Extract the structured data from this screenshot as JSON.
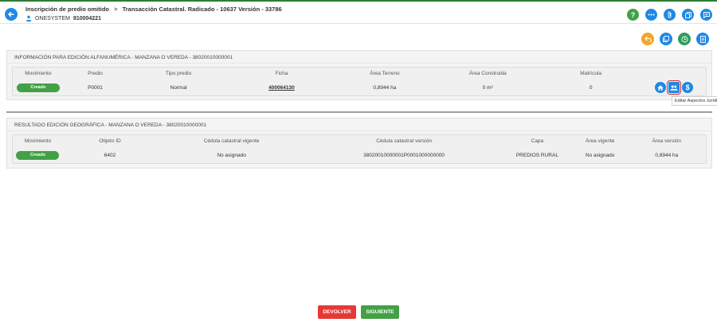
{
  "header": {
    "breadcrumb_1": "Inscripción de predio omitido",
    "breadcrumb_sep": ">",
    "breadcrumb_2": "Transacción Catastral. Radicado - 10637 Versión - 33786",
    "user_name": "ONESYSTEM",
    "user_id": "810004221",
    "icons": [
      "help-icon",
      "more-icon",
      "attachment-icon",
      "copy-icon",
      "comment-icon"
    ]
  },
  "actions": {
    "icons": [
      "undo-icon",
      "layers-icon",
      "history-icon",
      "document-icon"
    ]
  },
  "panel1": {
    "title": "INFORMACIÓN PARA EDICIÓN ALFANUMÉRICA - MANZANA O VEREDA - 38020010000001",
    "columns": [
      "Movimiento",
      "Predio",
      "Tipo predio",
      "Ficha",
      "Área Terreno",
      "Área Construida",
      "Matrícula"
    ],
    "row": {
      "movimiento": "Creado",
      "predio": "P0001",
      "tipo_predio": "Normal",
      "ficha": "400064130",
      "area_terreno": "0,8944 ha",
      "area_construida": "0 m²",
      "matricula": "0"
    },
    "row_icons": [
      "home-icon",
      "people-icon",
      "dollar-icon"
    ],
    "tooltip": "Editar Aspectos Jurídi"
  },
  "panel2": {
    "title": "RESULTADO EDICIÓN GEOGRÁFICA - MANZANA O VEREDA - 38020010000001",
    "columns": [
      "Movimiento",
      "Objeto ID",
      "Cédula catastral vigente",
      "Cédula catastral versión",
      "Capa",
      "Área vigente",
      "Área versión"
    ],
    "row": {
      "movimiento": "Creado",
      "objeto_id": "6402",
      "cedula_vigente": "No asignado",
      "cedula_version": "38020010000001P0001000000000",
      "capa": "PREDIOS RURAL",
      "area_vigente": "No asignado",
      "area_version": "0,8944 ha"
    }
  },
  "footer": {
    "devolver": "DEVOLVER",
    "siguiente": "SIGUIENTE"
  },
  "colors": {
    "accent_blue": "#1e88e5",
    "success_green": "#43a047",
    "warning_orange": "#f5a623",
    "danger_red": "#e53935"
  }
}
